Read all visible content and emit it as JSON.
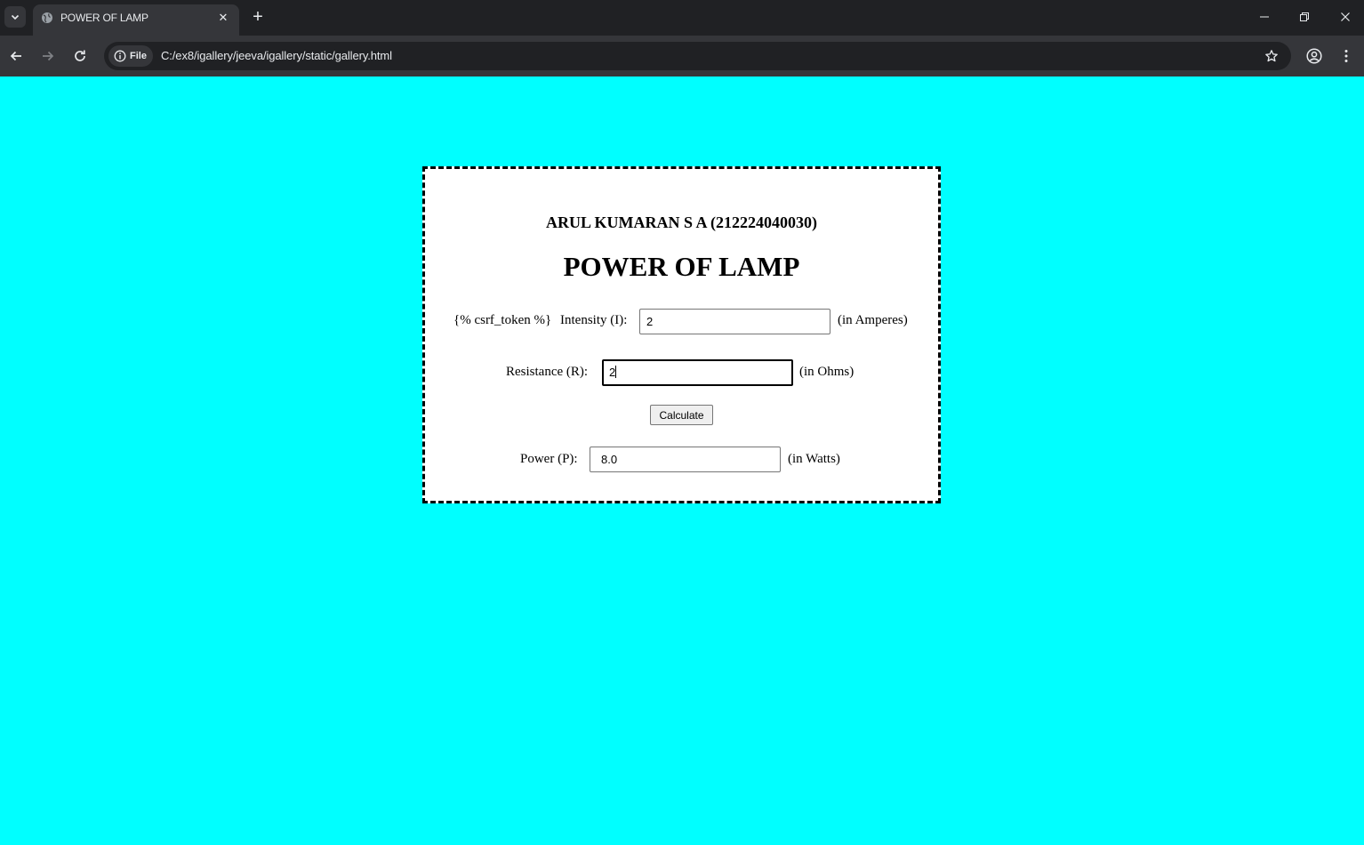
{
  "browser": {
    "tab_title": "POWER OF LAMP",
    "site_chip_label": "File",
    "url": "C:/ex8/igallery/jeeva/igallery/static/gallery.html",
    "tab_close_glyph": "✕",
    "new_tab_glyph": "+",
    "minimize_glyph": "—",
    "restore_glyph": "❐",
    "close_glyph": "✕"
  },
  "page": {
    "background_color": "#00ffff",
    "author": "ARUL KUMARAN S A (212224040030)",
    "title": "POWER OF LAMP",
    "csrf_text": "{% csrf_token %}",
    "intensity_label": "Intensity (I):",
    "intensity_value": "2",
    "intensity_unit": "(in Amperes)",
    "resistance_label": "Resistance (R):",
    "resistance_value": "2",
    "resistance_unit": "(in Ohms)",
    "calculate_label": "Calculate",
    "power_label": "Power (P):",
    "power_value": "8.0",
    "power_unit": "(in Watts)"
  },
  "icons": {
    "tab_list": "chevron-down-icon",
    "favicon": "globe-icon",
    "back": "arrow-left-icon",
    "forward": "arrow-right-icon",
    "reload": "reload-icon",
    "site_info": "info-icon",
    "bookmark": "star-icon",
    "profile": "profile-icon",
    "menu": "kebab-menu-icon"
  }
}
